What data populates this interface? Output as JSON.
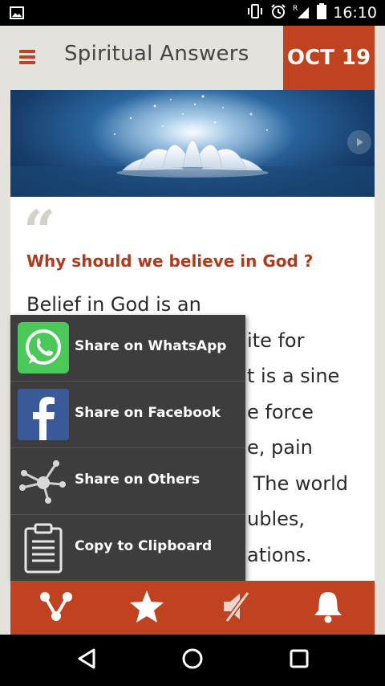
{
  "status_bar": {
    "time": "16:10",
    "icons": [
      "image-icon",
      "vibrate-icon",
      "alarm-icon",
      "signal-icon",
      "battery-icon"
    ],
    "roaming_indicator": "R"
  },
  "header": {
    "menu_icon": "hamburger-menu-icon",
    "title": "Spiritual Answers",
    "date": "OCT 19"
  },
  "banner": {
    "image": "lotus-flower-image",
    "next_icon": "chevron-right-icon"
  },
  "content": {
    "quote_icon": "quote-icon",
    "question": "Why should we believe in God ?",
    "answer_lines": [
      "Belief in God is an",
      "ite for",
      "t is a sine",
      "e force",
      "e, pain",
      " The world",
      "ubles,",
      "ations."
    ]
  },
  "share_menu": {
    "items": [
      {
        "label": "Share on WhatsApp",
        "icon": "whatsapp-icon"
      },
      {
        "label": "Share on Facebook",
        "icon": "facebook-icon"
      },
      {
        "label": "Share on Others",
        "icon": "share-nodes-icon"
      },
      {
        "label": "Copy to Clipboard",
        "icon": "clipboard-icon"
      }
    ]
  },
  "bottom_bar": {
    "items": [
      "share-icon",
      "star-icon",
      "mute-icon",
      "bell-icon"
    ]
  },
  "nav_bar": {
    "items": [
      "back-icon",
      "home-icon",
      "recents-icon"
    ]
  },
  "colors": {
    "accent": "#c0421f",
    "background": "#e4e2dc",
    "menu_bg": "#3d3d3d",
    "whatsapp": "#4ac959",
    "facebook": "#3b5998"
  }
}
